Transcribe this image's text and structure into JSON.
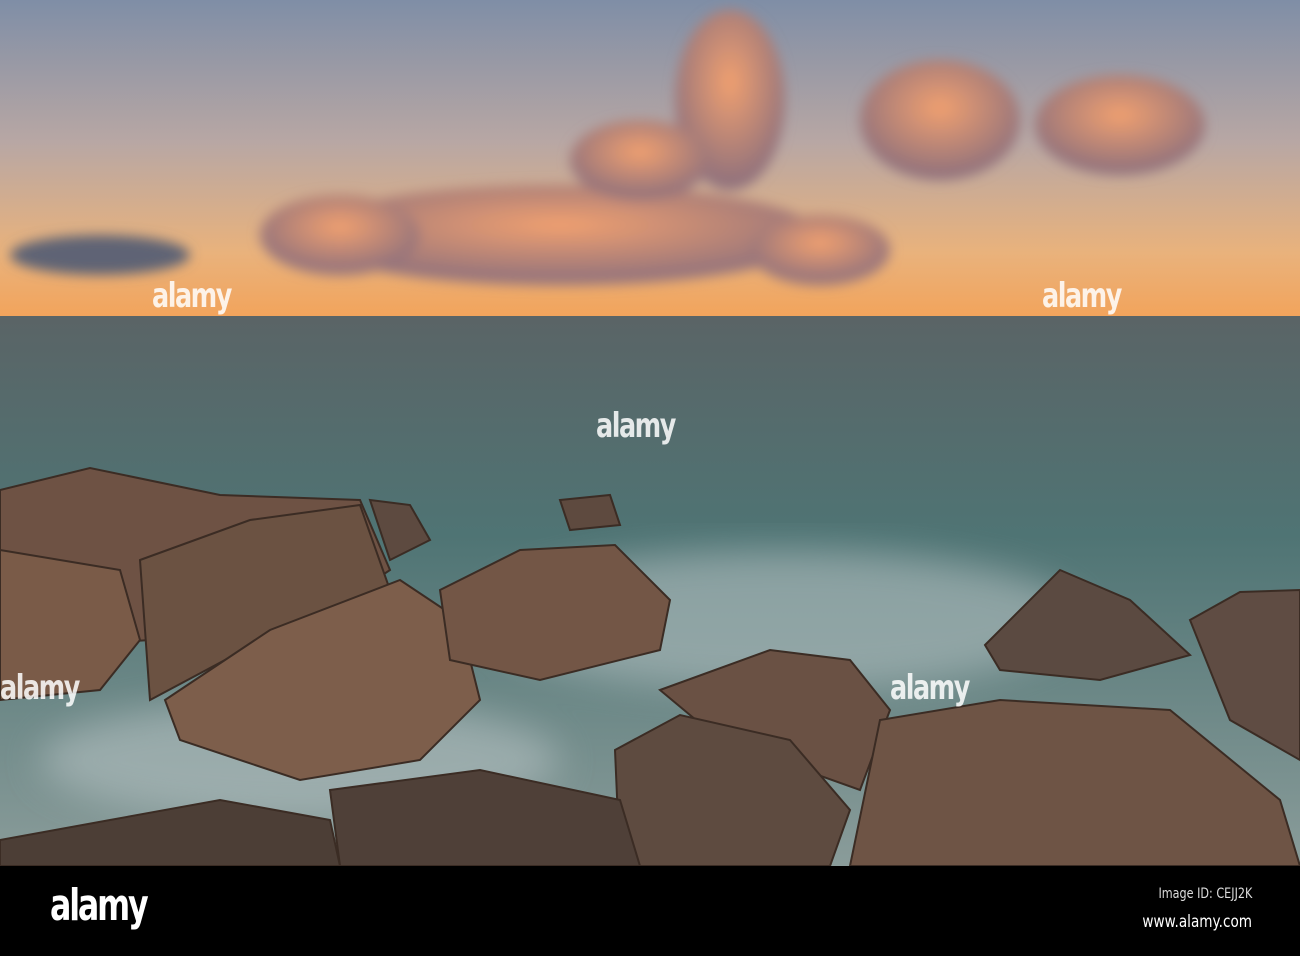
{
  "photo": {
    "subject": "rocky shoreline at sunset",
    "colors": {
      "sky_top": "#7f8ea6",
      "sky_horizon": "#f0a860",
      "sea": "#5f7a78",
      "rock": "#6b5040"
    }
  },
  "watermark": {
    "text": "alamy"
  },
  "footer": {
    "logo": "alamy",
    "image_id": "Image ID: CEJJ2K",
    "website": "www.alamy.com"
  }
}
